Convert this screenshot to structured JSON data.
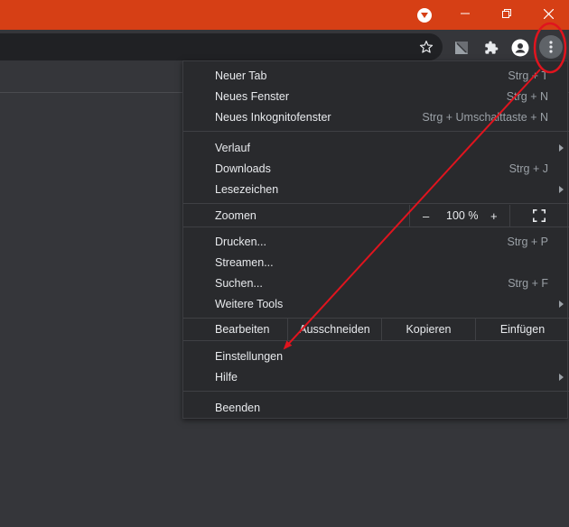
{
  "menu": {
    "group1": [
      {
        "label": "Neuer Tab",
        "shortcut": "Strg + T"
      },
      {
        "label": "Neues Fenster",
        "shortcut": "Strg + N"
      },
      {
        "label": "Neues Inkognitofenster",
        "shortcut": "Strg + Umschalttaste + N"
      }
    ],
    "group2": [
      {
        "label": "Verlauf",
        "shortcut": ""
      },
      {
        "label": "Downloads",
        "shortcut": "Strg + J"
      },
      {
        "label": "Lesezeichen",
        "shortcut": ""
      }
    ],
    "zoom": {
      "label": "Zoomen",
      "minus": "–",
      "value": "100 %",
      "plus": "+"
    },
    "group3": [
      {
        "label": "Drucken...",
        "shortcut": "Strg + P"
      },
      {
        "label": "Streamen...",
        "shortcut": ""
      },
      {
        "label": "Suchen...",
        "shortcut": "Strg + F"
      },
      {
        "label": "Weitere Tools",
        "shortcut": ""
      }
    ],
    "edit": {
      "label": "Bearbeiten",
      "cut": "Ausschneiden",
      "copy": "Kopieren",
      "paste": "Einfügen"
    },
    "group4": [
      {
        "label": "Einstellungen",
        "shortcut": ""
      },
      {
        "label": "Hilfe",
        "shortcut": ""
      }
    ],
    "exit": {
      "label": "Beenden"
    }
  },
  "colors": {
    "titlebar": "#d63f15",
    "annotation": "#e0141e"
  },
  "icons": {
    "profile": "profile-dropdown-icon",
    "minimize": "minimize-icon",
    "restore": "restore-icon",
    "close": "close-icon",
    "star": "bookmark-star-icon",
    "extension_app": "extension-app-icon",
    "extensions": "puzzle-icon",
    "account": "account-icon",
    "menu": "three-dots-menu-icon"
  }
}
